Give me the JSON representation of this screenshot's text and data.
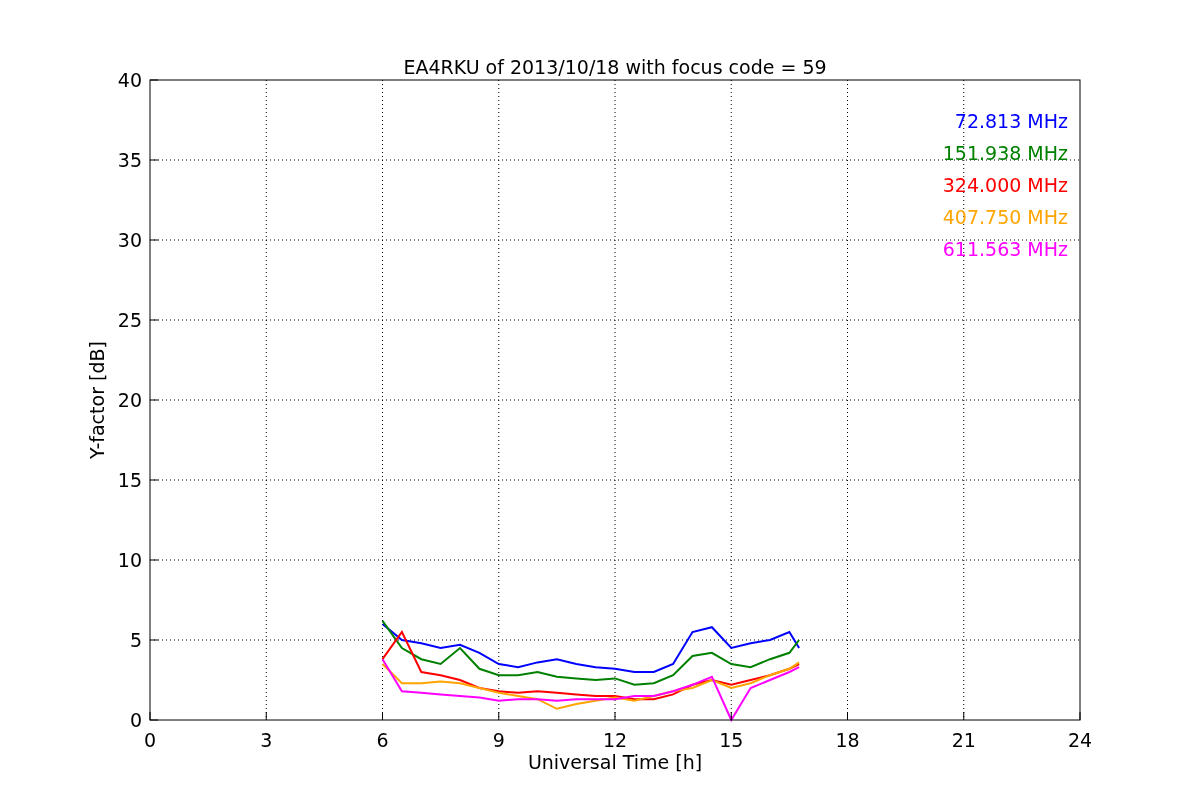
{
  "figure": {
    "chart_data": {
      "type": "line",
      "title": "EA4RKU of 2013/10/18 with focus code = 59",
      "xlabel": "Universal Time [h]",
      "ylabel": "Y-factor [dB]",
      "x": [
        6,
        6.5,
        7,
        7.5,
        8,
        8.5,
        9,
        9.5,
        10,
        10.5,
        11,
        11.5,
        12,
        12.5,
        13,
        13.5,
        14,
        14.5,
        15,
        15.5,
        16,
        16.5,
        16.75
      ],
      "series": [
        {
          "name": "72.813 MHz",
          "color": "#0000ff",
          "values": [
            6.0,
            5.0,
            4.8,
            4.5,
            4.7,
            4.2,
            3.5,
            3.3,
            3.6,
            3.8,
            3.5,
            3.3,
            3.2,
            3.0,
            3.0,
            3.5,
            5.5,
            5.8,
            4.5,
            4.8,
            5.0,
            5.5,
            4.5
          ]
        },
        {
          "name": "151.938 MHz",
          "color": "#008000",
          "values": [
            6.2,
            4.5,
            3.8,
            3.5,
            4.5,
            3.2,
            2.8,
            2.8,
            3.0,
            2.7,
            2.6,
            2.5,
            2.6,
            2.2,
            2.3,
            2.8,
            4.0,
            4.2,
            3.5,
            3.3,
            3.8,
            4.2,
            5.0
          ]
        },
        {
          "name": "324.000 MHz",
          "color": "#ff0000",
          "values": [
            3.8,
            5.5,
            3.0,
            2.8,
            2.5,
            2.0,
            1.8,
            1.7,
            1.8,
            1.7,
            1.6,
            1.5,
            1.5,
            1.3,
            1.3,
            1.6,
            2.2,
            2.5,
            2.2,
            2.5,
            2.8,
            3.2,
            3.5
          ]
        },
        {
          "name": "407.750 MHz",
          "color": "#ffa500",
          "values": [
            3.5,
            2.3,
            2.3,
            2.4,
            2.3,
            2.0,
            1.7,
            1.5,
            1.3,
            0.7,
            1.0,
            1.2,
            1.4,
            1.2,
            1.5,
            1.8,
            2.0,
            2.5,
            2.0,
            2.3,
            2.8,
            3.2,
            3.6
          ]
        },
        {
          "name": "611.563 MHz",
          "color": "#ff00ff",
          "values": [
            3.8,
            1.8,
            1.7,
            1.6,
            1.5,
            1.4,
            1.2,
            1.3,
            1.3,
            1.2,
            1.3,
            1.3,
            1.3,
            1.5,
            1.5,
            1.8,
            2.2,
            2.7,
            0.0,
            2.0,
            2.5,
            3.0,
            3.3
          ]
        }
      ],
      "grid": true,
      "xlim": [
        0,
        24
      ],
      "ylim": [
        0,
        40
      ],
      "xticks": [
        0,
        3,
        6,
        9,
        12,
        15,
        18,
        21,
        24
      ],
      "yticks": [
        0,
        5,
        10,
        15,
        20,
        25,
        30,
        35,
        40
      ]
    }
  }
}
